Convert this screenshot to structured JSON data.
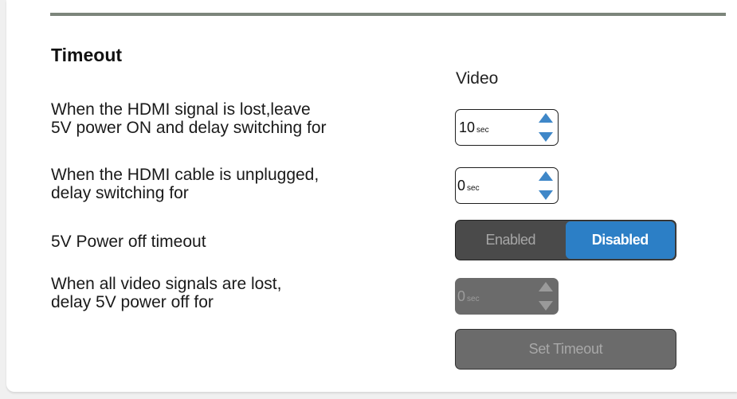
{
  "section": {
    "title": "Timeout",
    "column_header": "Video"
  },
  "rows": {
    "hdmi_signal_lost": {
      "label_line1": "When the HDMI signal is lost,leave",
      "label_line2": "5V power ON and delay switching for",
      "value": "10",
      "unit": "sec"
    },
    "hdmi_cable_unplugged": {
      "label_line1": "When the HDMI cable is unplugged,",
      "label_line2": "delay switching for",
      "value": "0",
      "unit": "sec"
    },
    "power_off_timeout": {
      "label": "5V Power off timeout",
      "enabled_label": "Enabled",
      "disabled_label": "Disabled",
      "selected": "Disabled"
    },
    "all_signals_lost": {
      "label_line1": "When all video signals are lost,",
      "label_line2": "delay 5V power off for",
      "value": "0",
      "unit": "sec",
      "disabled": true
    }
  },
  "buttons": {
    "set_timeout": "Set Timeout"
  },
  "colors": {
    "accent": "#2c7fc6",
    "divider": "#7c857b",
    "disabled_bg": "#6b6b6b",
    "toggle_bg": "#4a4a4a",
    "arrow_active": "#3f87c8",
    "arrow_disabled": "#9a9a9a"
  },
  "icons": {
    "spin_up": "triangle-up-icon",
    "spin_down": "triangle-down-icon"
  }
}
